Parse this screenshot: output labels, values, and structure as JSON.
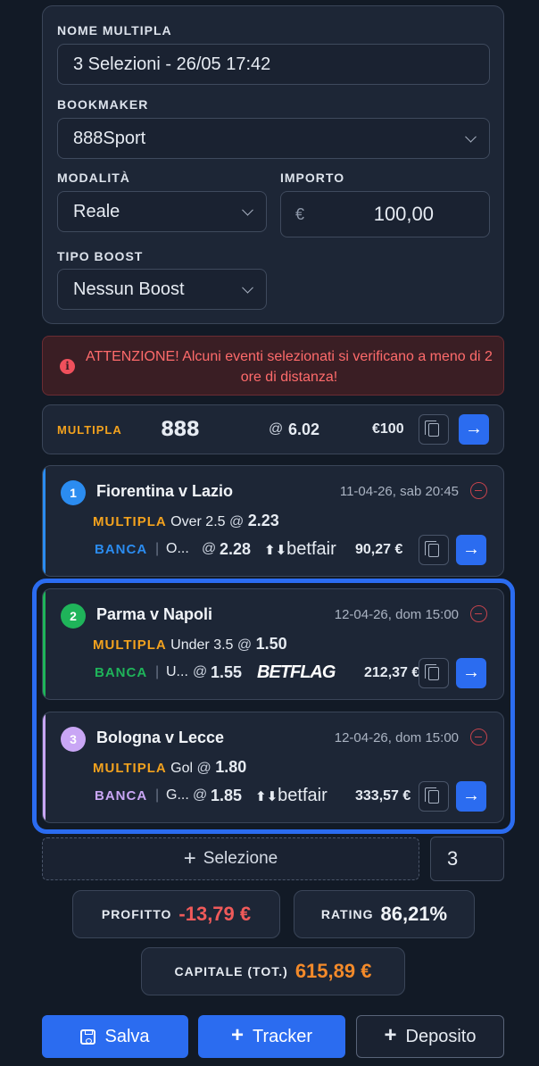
{
  "form": {
    "name_label": "NOME MULTIPLA",
    "name_value": "3 Selezioni - 26/05 17:42",
    "bookmaker_label": "BOOKMAKER",
    "bookmaker_value": "888Sport",
    "mode_label": "MODALITÀ",
    "mode_value": "Reale",
    "amount_label": "IMPORTO",
    "currency": "€",
    "amount_value": "100,00",
    "boost_label": "TIPO BOOST",
    "boost_value": "Nessun Boost"
  },
  "warning": {
    "icon": "info-icon",
    "text": "ATTENZIONE! Alcuni eventi selezionati si verificano a meno di 2 ore di distanza!"
  },
  "summary": {
    "label": "MULTIPLA",
    "bookmaker_logo": "888",
    "at": "@",
    "odds": "6.02",
    "stake": "€100"
  },
  "selections": [
    {
      "number": "1",
      "color": "#2b8cf0",
      "match": "Fiorentina v Lazio",
      "date": "11-04-26, sab 20:45",
      "multi_label": "MULTIPLA",
      "multi_market": "Over 2.5",
      "multi_odds": "2.23",
      "bank_label": "BANCA",
      "bank_market": "O...",
      "bank_odds": "2.28",
      "exchange": "betfair",
      "bank_amount": "90,27 €"
    },
    {
      "number": "2",
      "color": "#1fb45a",
      "match": "Parma v Napoli",
      "date": "12-04-26, dom 15:00",
      "multi_label": "MULTIPLA",
      "multi_market": "Under 3.5",
      "multi_odds": "1.50",
      "bank_label": "BANCA",
      "bank_market": "U...",
      "bank_odds": "1.55",
      "exchange": "BETFLAG",
      "bank_amount": "212,37 €"
    },
    {
      "number": "3",
      "color": "#c9a6f5",
      "match": "Bologna v Lecce",
      "date": "12-04-26, dom 15:00",
      "multi_label": "MULTIPLA",
      "multi_market": "Gol",
      "multi_odds": "1.80",
      "bank_label": "BANCA",
      "bank_market": "G...",
      "bank_odds": "1.85",
      "exchange": "betfair",
      "bank_amount": "333,57 €"
    }
  ],
  "add_selection": {
    "plus": "+",
    "label": "Selezione",
    "count": "3"
  },
  "stats": {
    "profit_label": "PROFITTO",
    "profit_value": "-13,79 €",
    "rating_label": "RATING",
    "rating_value": "86,21%",
    "capital_label": "CAPITALE (TOT.)",
    "capital_value": "615,89 €"
  },
  "buttons": {
    "save": "Salva",
    "tracker": "Tracker",
    "deposit": "Deposito",
    "plus": "+"
  },
  "colors": {
    "accent": "#2b6cf0",
    "orange": "#f3a21e",
    "negative": "#f05a5a",
    "warning_text": "#ff6b6b"
  }
}
